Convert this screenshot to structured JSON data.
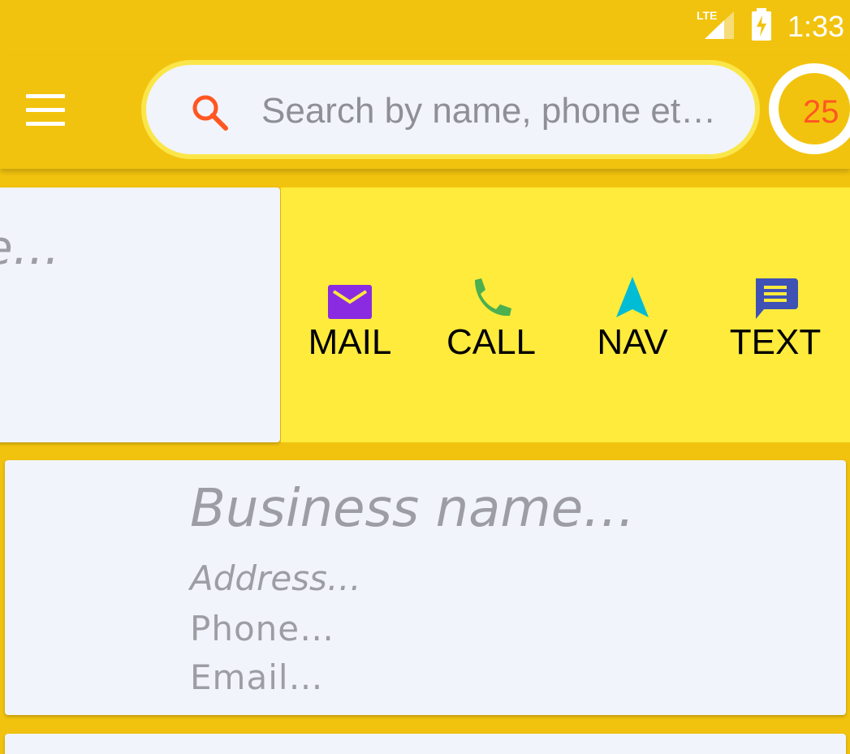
{
  "status_bar": {
    "network_icon": "lte-signal-icon",
    "battery_icon": "battery-charging-icon",
    "time": "1:33"
  },
  "app_bar": {
    "menu_icon": "hamburger-menu-icon",
    "search": {
      "icon": "search-icon",
      "placeholder": "Search by name, phone et…",
      "value": ""
    },
    "count_badge": "25"
  },
  "cards": {
    "first": {
      "title_peek": "e…"
    },
    "actions": [
      {
        "label": "MAIL",
        "icon": "mail-icon",
        "color": "#8a2be2"
      },
      {
        "label": "CALL",
        "icon": "phone-icon",
        "color": "#4caf50"
      },
      {
        "label": "NAV",
        "icon": "navigation-arrow-icon",
        "color": "#00bcd4"
      },
      {
        "label": "TEXT",
        "icon": "message-icon",
        "color": "#3f51b5"
      }
    ],
    "second": {
      "business_name": "Business name…",
      "address": "Address…",
      "phone": "Phone…",
      "email": "Email…"
    }
  },
  "colors": {
    "app_bar": "#f2c30e",
    "action_bar": "#ffeb3b",
    "card": "#f1f4fb",
    "accent": "#ff5722"
  }
}
